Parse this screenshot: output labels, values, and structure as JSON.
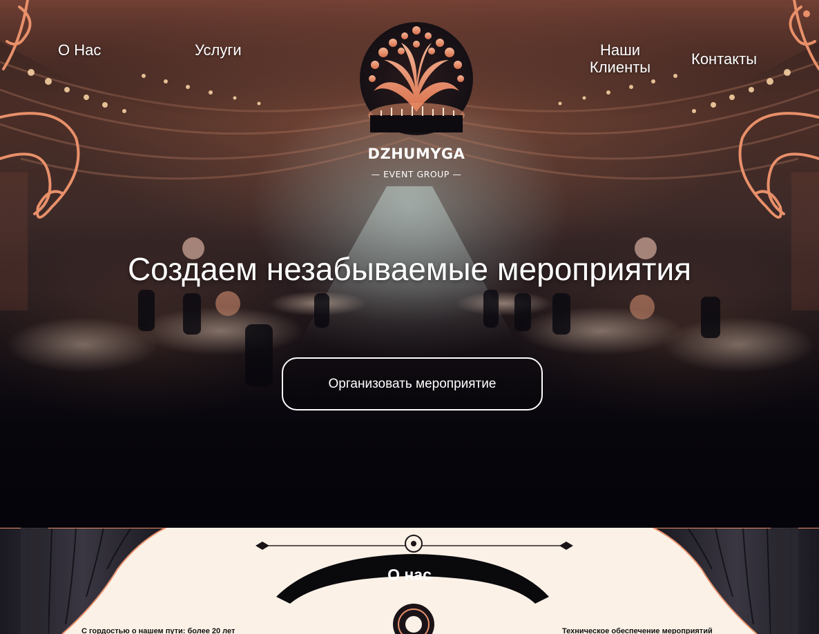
{
  "nav": {
    "about": "О Нас",
    "services": "Услуги",
    "clients": "Наши\nКлиенты",
    "contacts": "Контакты"
  },
  "logo": {
    "name": "DZHUMYGA",
    "subtitle": "— EVENT GROUP —"
  },
  "hero": {
    "title": "Создаем незабываемые мероприятия",
    "cta": "Организовать мероприятие"
  },
  "about": {
    "heading": "О нас",
    "left_text": "С гордостью о нашем пути: более 20 лет",
    "right_text": "Техническое обеспечение мероприятий"
  },
  "colors": {
    "accent_copper": "#e8906a",
    "cream": "#fbf1e7",
    "dark": "#07060c"
  }
}
